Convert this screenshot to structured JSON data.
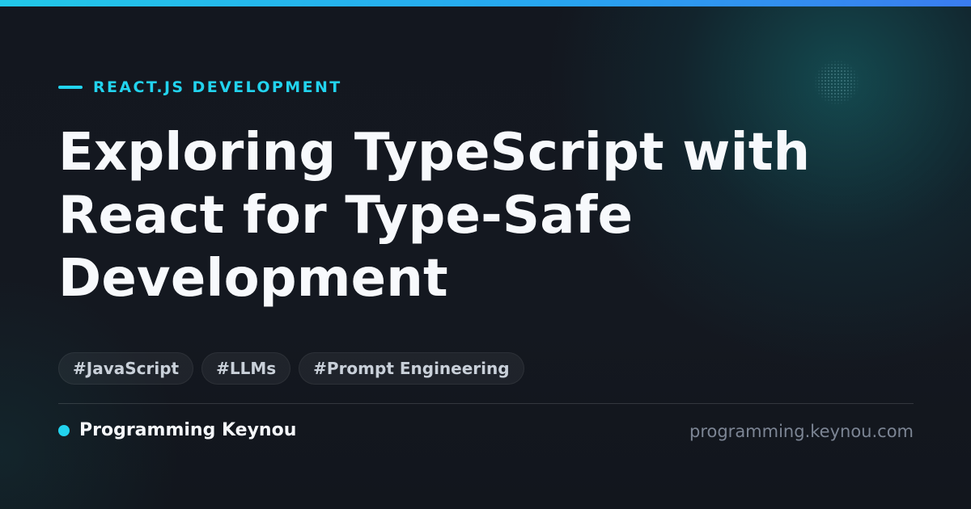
{
  "category": {
    "label": "REACT.JS DEVELOPMENT"
  },
  "title": {
    "text": "Exploring TypeScript with React for Type-Safe Development"
  },
  "tags": [
    {
      "label": "#JavaScript"
    },
    {
      "label": "#LLMs"
    },
    {
      "label": "#Prompt Engineering"
    }
  ],
  "footer": {
    "brand_name": "Programming Keynou",
    "site_url": "programming.keynou.com"
  },
  "colors": {
    "accent": "#22d3ee",
    "background": "#141820",
    "title": "#f7f9fc",
    "muted": "#7c8594"
  }
}
